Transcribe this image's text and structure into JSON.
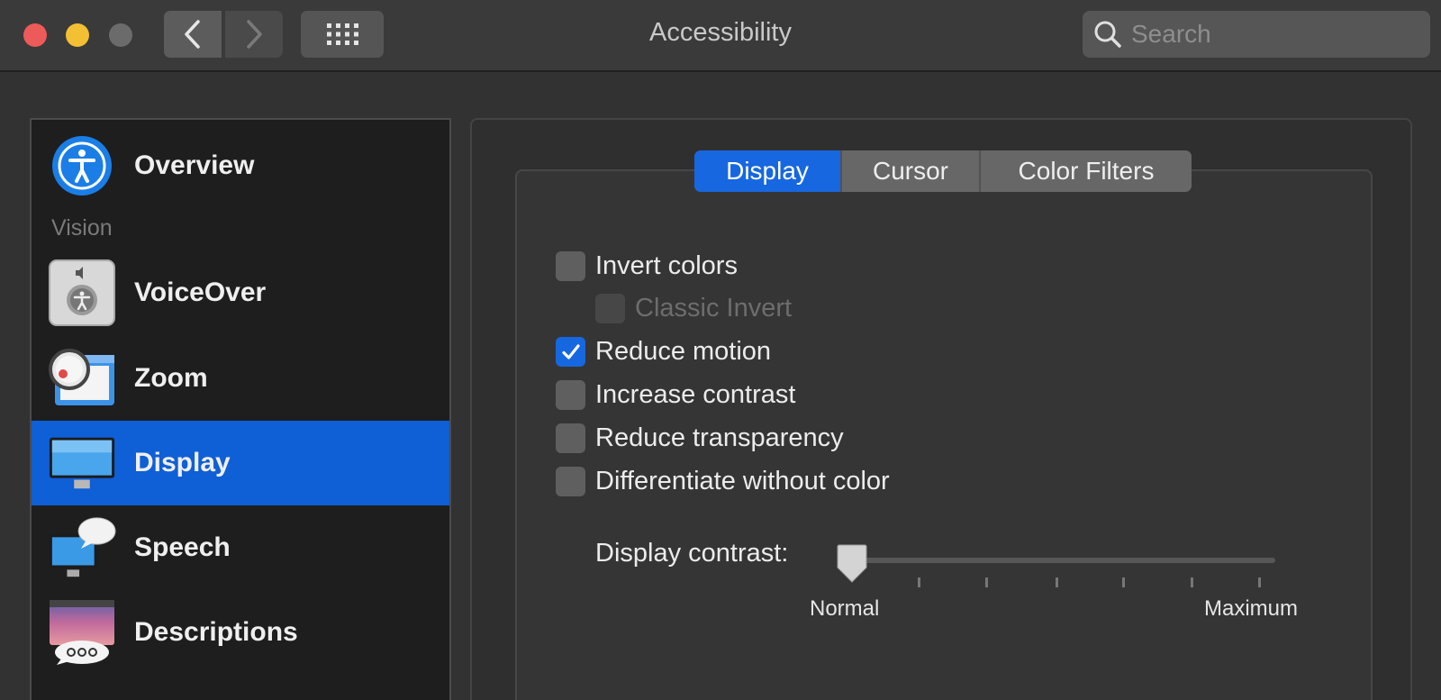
{
  "window": {
    "title": "Accessibility",
    "search_placeholder": "Search"
  },
  "sidebar": {
    "section_vision": "Vision",
    "items": [
      {
        "label": "Overview"
      },
      {
        "label": "VoiceOver"
      },
      {
        "label": "Zoom"
      },
      {
        "label": "Display",
        "selected": true
      },
      {
        "label": "Speech"
      },
      {
        "label": "Descriptions"
      }
    ]
  },
  "tabs": [
    {
      "label": "Display",
      "active": true
    },
    {
      "label": "Cursor"
    },
    {
      "label": "Color Filters"
    }
  ],
  "options": [
    {
      "label": "Invert colors",
      "checked": false
    },
    {
      "label": "Classic Invert",
      "checked": false,
      "disabled": true
    },
    {
      "label": "Reduce motion",
      "checked": true
    },
    {
      "label": "Increase contrast",
      "checked": false
    },
    {
      "label": "Reduce transparency",
      "checked": false
    },
    {
      "label": "Differentiate without color",
      "checked": false
    }
  ],
  "contrast": {
    "label": "Display contrast:",
    "min_label": "Normal",
    "max_label": "Maximum",
    "value": 0
  },
  "colors": {
    "accent": "#1767e0",
    "sidebar_selected": "#0f5fd6"
  }
}
